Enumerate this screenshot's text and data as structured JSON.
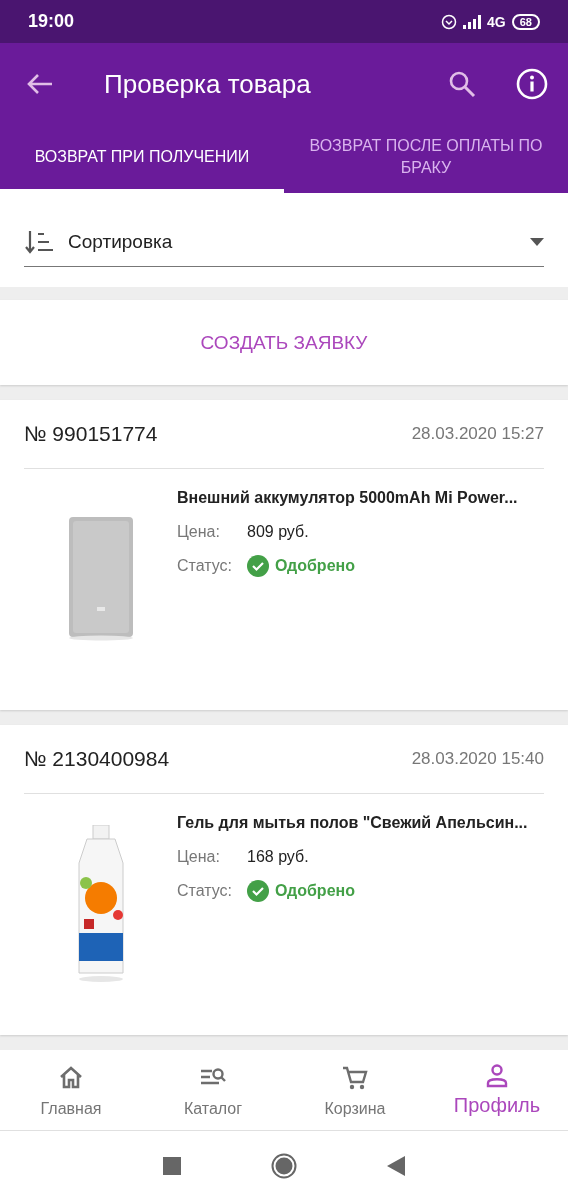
{
  "status_bar": {
    "time": "19:00",
    "network": "4G",
    "battery": "68"
  },
  "app_bar": {
    "title": "Проверка товара"
  },
  "tabs": [
    {
      "label": "ВОЗВРАТ ПРИ ПОЛУЧЕНИИ",
      "selected": true
    },
    {
      "label": "ВОЗВРАТ ПОСЛЕ ОПЛАТЫ ПО БРАКУ",
      "selected": false
    }
  ],
  "sort": {
    "value": "Сортировка"
  },
  "create_button": "СОЗДАТЬ ЗАЯВКУ",
  "orders": [
    {
      "number": "№ 990151774",
      "date": "28.03.2020 15:27",
      "product": "Внешний аккумулятор 5000mAh Mi Power...",
      "price_label": "Цена:",
      "price": "809 руб.",
      "status_label": "Статус:",
      "status": "Одобрено"
    },
    {
      "number": "№ 2130400984",
      "date": "28.03.2020 15:40",
      "product": "Гель для мытья полов \"Свежий Апельсин...",
      "price_label": "Цена:",
      "price": "168 руб.",
      "status_label": "Статус:",
      "status": "Одобрено"
    }
  ],
  "bottom_nav": [
    {
      "label": "Главная",
      "selected": false
    },
    {
      "label": "Каталог",
      "selected": false
    },
    {
      "label": "Корзина",
      "selected": false
    },
    {
      "label": "Профиль",
      "selected": true
    }
  ]
}
